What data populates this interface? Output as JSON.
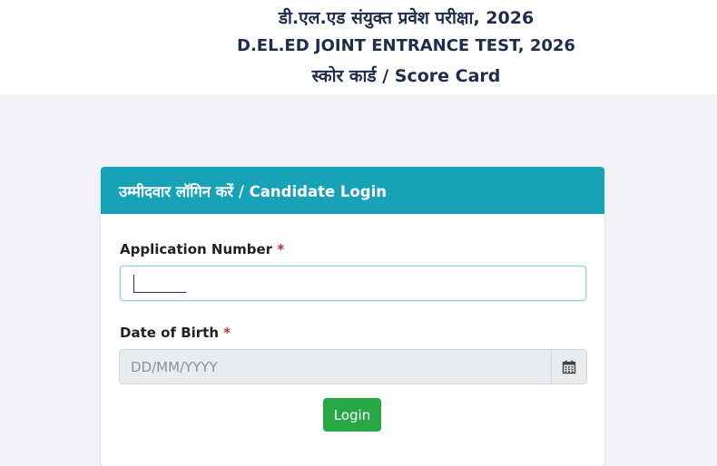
{
  "header": {
    "title_hindi": "डी.एल.एड संयुक्त प्रवेश परीक्षा, 2026",
    "title_english": "D.EL.ED JOINT ENTRANCE TEST, 2026",
    "subtitle": "स्कोर कार्ड / Score Card"
  },
  "login_card": {
    "heading": "उम्मीदवार लॉगिन करें / Candidate Login",
    "application_number": {
      "label": "Application Number",
      "required_mark": "*",
      "value": ""
    },
    "date_of_birth": {
      "label": "Date of Birth",
      "required_mark": "*",
      "placeholder": "DD/MM/YYYY",
      "icon": "calendar-icon"
    },
    "login_button": "Login"
  },
  "colors": {
    "card_header": "#17a2b8",
    "login_button": "#28a745",
    "required": "#d62828",
    "title_text": "#1f2d4d"
  }
}
